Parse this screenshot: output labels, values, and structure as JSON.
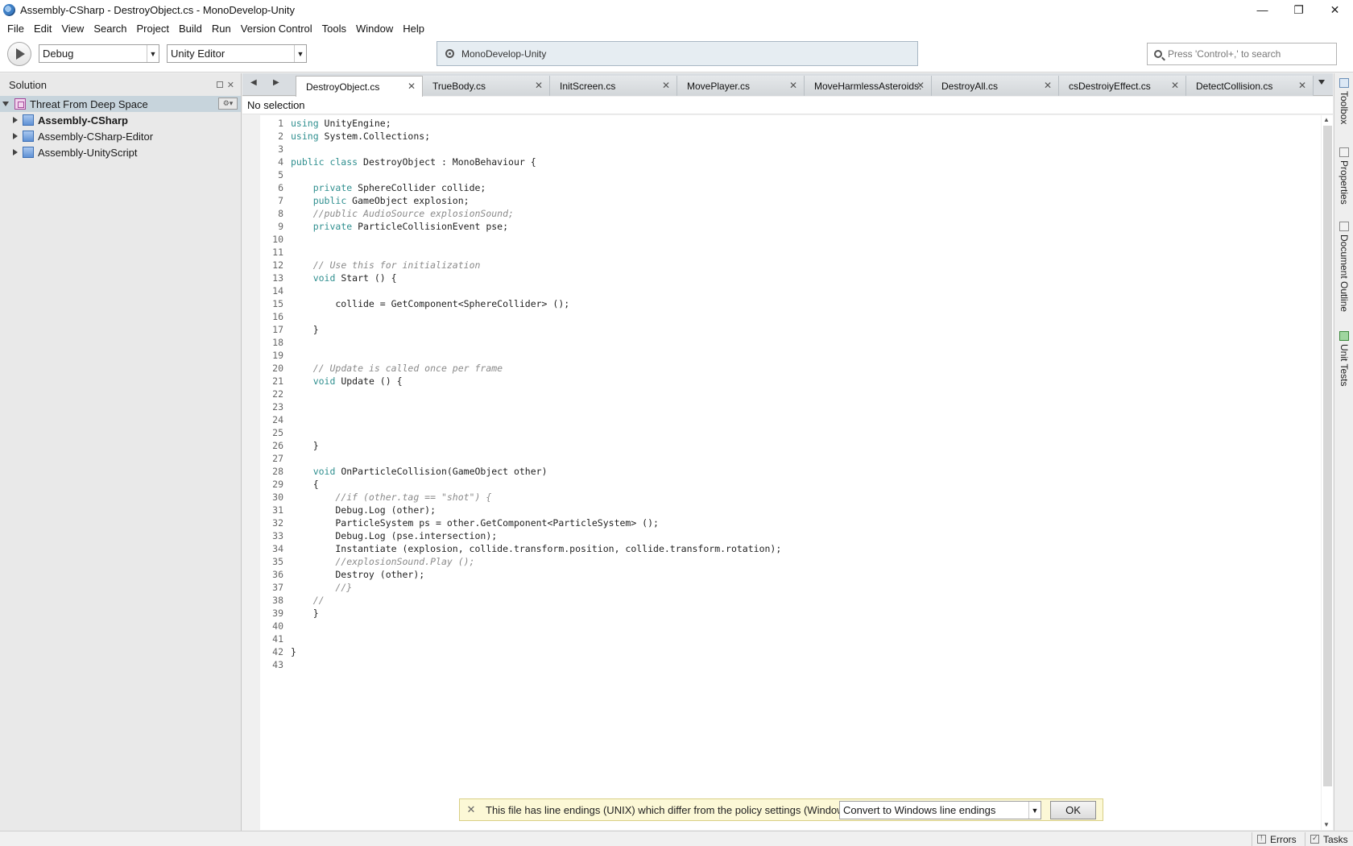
{
  "window": {
    "title": "Assembly-CSharp - DestroyObject.cs - MonoDevelop-Unity",
    "minimize": "—",
    "restore": "❐",
    "close": "✕"
  },
  "menu": [
    "File",
    "Edit",
    "View",
    "Search",
    "Project",
    "Build",
    "Run",
    "Version Control",
    "Tools",
    "Window",
    "Help"
  ],
  "toolbar": {
    "config": "Debug",
    "target": "Unity Editor",
    "status": "MonoDevelop-Unity",
    "search_placeholder": "Press 'Control+,' to search"
  },
  "solution": {
    "title": "Solution",
    "root": "Threat From Deep Space",
    "projects": [
      "Assembly-CSharp",
      "Assembly-CSharp-Editor",
      "Assembly-UnityScript"
    ]
  },
  "tabs": [
    "DestroyObject.cs",
    "TrueBody.cs",
    "InitScreen.cs",
    "MovePlayer.cs",
    "MoveHarmlessAsteroids.",
    "DestroyAll.cs",
    "csDestroiyEffect.cs",
    "DetectCollision.cs"
  ],
  "editor": {
    "path": "No selection",
    "lines": [
      [
        [
          "k",
          "using"
        ],
        [
          "t",
          " UnityEngine;"
        ]
      ],
      [
        [
          "k",
          "using"
        ],
        [
          "t",
          " System.Collections;"
        ]
      ],
      [],
      [
        [
          "k",
          "public class"
        ],
        [
          "t",
          " DestroyObject : MonoBehaviour {"
        ]
      ],
      [],
      [
        [
          "t",
          "    "
        ],
        [
          "k",
          "private"
        ],
        [
          "t",
          " SphereCollider collide;"
        ]
      ],
      [
        [
          "t",
          "    "
        ],
        [
          "k",
          "public"
        ],
        [
          "t",
          " GameObject explosion;"
        ]
      ],
      [
        [
          "t",
          "    "
        ],
        [
          "c",
          "//public AudioSource explosionSound;"
        ]
      ],
      [
        [
          "t",
          "    "
        ],
        [
          "k",
          "private"
        ],
        [
          "t",
          " ParticleCollisionEvent pse;"
        ]
      ],
      [],
      [],
      [
        [
          "t",
          "    "
        ],
        [
          "c",
          "// Use this for initialization"
        ]
      ],
      [
        [
          "t",
          "    "
        ],
        [
          "k",
          "void"
        ],
        [
          "t",
          " Start () {"
        ]
      ],
      [],
      [
        [
          "t",
          "        collide = GetComponent<SphereCollider> ();"
        ]
      ],
      [],
      [
        [
          "t",
          "    }"
        ]
      ],
      [],
      [],
      [
        [
          "t",
          "    "
        ],
        [
          "c",
          "// Update is called once per frame"
        ]
      ],
      [
        [
          "t",
          "    "
        ],
        [
          "k",
          "void"
        ],
        [
          "t",
          " Update () {"
        ]
      ],
      [],
      [],
      [],
      [],
      [
        [
          "t",
          "    }"
        ]
      ],
      [],
      [
        [
          "t",
          "    "
        ],
        [
          "k",
          "void"
        ],
        [
          "t",
          " OnParticleCollision(GameObject other)"
        ]
      ],
      [
        [
          "t",
          "    {"
        ]
      ],
      [
        [
          "t",
          "        "
        ],
        [
          "c",
          "//if (other.tag == \"shot\") {"
        ]
      ],
      [
        [
          "t",
          "        Debug.Log (other);"
        ]
      ],
      [
        [
          "t",
          "        ParticleSystem ps = other.GetComponent<ParticleSystem> ();"
        ]
      ],
      [
        [
          "t",
          "        Debug.Log (pse.intersection);"
        ]
      ],
      [
        [
          "t",
          "        Instantiate (explosion, collide.transform.position, collide.transform.rotation);"
        ]
      ],
      [
        [
          "t",
          "        "
        ],
        [
          "c",
          "//explosionSound.Play ();"
        ]
      ],
      [
        [
          "t",
          "        Destroy (other);"
        ]
      ],
      [
        [
          "t",
          "        "
        ],
        [
          "c",
          "//}"
        ]
      ],
      [
        [
          "t",
          "    "
        ],
        [
          "c",
          "//"
        ]
      ],
      [
        [
          "t",
          "    }"
        ]
      ],
      [],
      [],
      [
        [
          "t",
          "}"
        ]
      ],
      []
    ]
  },
  "dock": [
    "Toolbox",
    "Properties",
    "Document Outline",
    "Unit Tests"
  ],
  "infobar": {
    "message": "This file has line endings (UNIX) which differ from the policy settings (Windows).",
    "option": "Convert to Windows line endings",
    "ok": "OK",
    "close": "✕"
  },
  "statusbar": {
    "errors": "Errors",
    "tasks": "Tasks"
  },
  "colors": {
    "keyword": "#2f8f8f",
    "comment": "#8a8a8a",
    "selection": "#c7d4dc",
    "infobar": "#fcf8d6"
  }
}
